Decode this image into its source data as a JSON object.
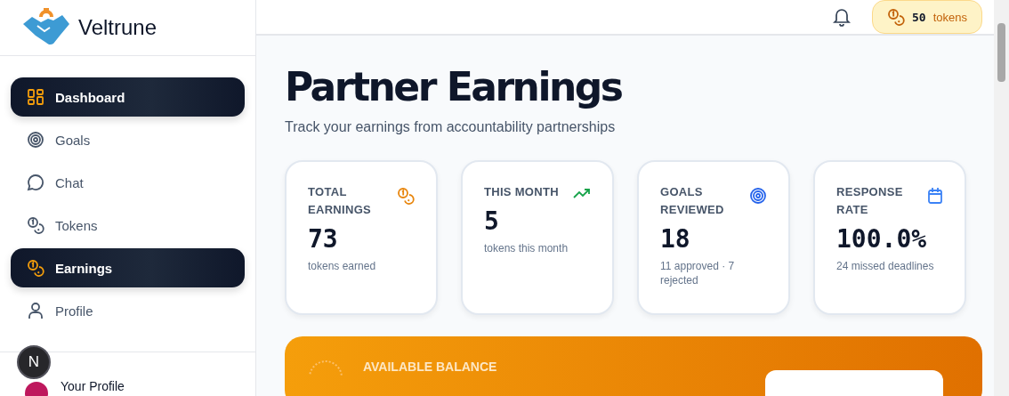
{
  "brand": {
    "name": "Veltrune"
  },
  "nav": [
    {
      "label": "Dashboard",
      "kind": "grid",
      "selected": true
    },
    {
      "label": "Goals",
      "kind": "target",
      "selected": false
    },
    {
      "label": "Chat",
      "kind": "chat",
      "selected": false
    },
    {
      "label": "Tokens",
      "kind": "coins",
      "selected": false
    },
    {
      "label": "Earnings",
      "kind": "coins",
      "selected": true
    },
    {
      "label": "Profile",
      "kind": "user",
      "selected": false
    }
  ],
  "dev_badge": {
    "label": "N"
  },
  "profile": {
    "label": "Your Profile"
  },
  "header": {
    "token_count": "50",
    "token_unit": "tokens"
  },
  "page": {
    "title": "Partner Earnings",
    "subtitle": "Track your earnings from accountability partnerships"
  },
  "stats": [
    {
      "label": "TOTAL EARNINGS",
      "value": "73",
      "note": "tokens earned",
      "kind": "coins",
      "color": "#e8850c"
    },
    {
      "label": "THIS MONTH",
      "value": "5",
      "note": "tokens this month",
      "kind": "trend",
      "color": "#16a34a"
    },
    {
      "label": "GOALS REVIEWED",
      "value": "18",
      "note": "11 approved · 7 rejected",
      "kind": "target",
      "color": "#2563eb"
    },
    {
      "label": "RESPONSE RATE",
      "value": "100.0%",
      "note": "24 missed deadlines",
      "kind": "calendar",
      "color": "#3b82f6"
    }
  ],
  "balance": {
    "label": "AVAILABLE BALANCE"
  }
}
